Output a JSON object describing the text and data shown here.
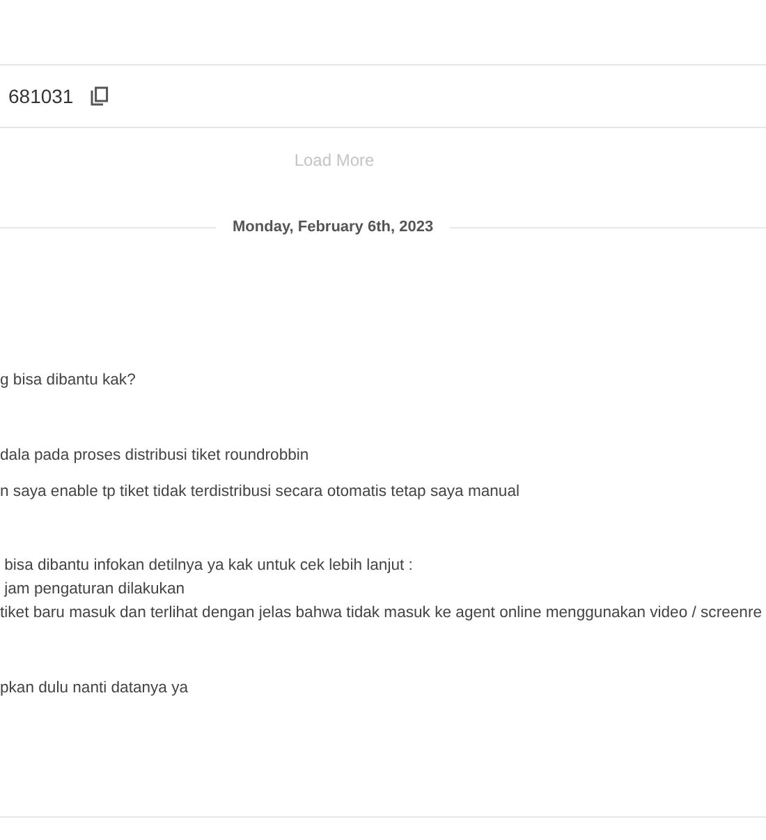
{
  "ticket": {
    "number": "681031"
  },
  "load_more": "Load More",
  "date_divider": "Monday, February 6th, 2023",
  "messages": [
    {
      "lines": [
        "g bisa dibantu kak?"
      ]
    },
    {
      "lines": [
        "dala pada proses distribusi tiket roundrobbin"
      ]
    },
    {
      "lines": [
        "n saya enable tp tiket tidak terdistribusi secara otomatis tetap saya manual"
      ]
    },
    {
      "lines": [
        " bisa dibantu infokan detilnya ya kak untuk cek lebih lanjut :",
        " jam pengaturan dilakukan",
        "tiket baru masuk dan terlihat dengan jelas bahwa tidak masuk ke agent online menggunakan video / screenre"
      ]
    },
    {
      "lines": [
        "pkan dulu nanti datanya ya"
      ]
    }
  ]
}
